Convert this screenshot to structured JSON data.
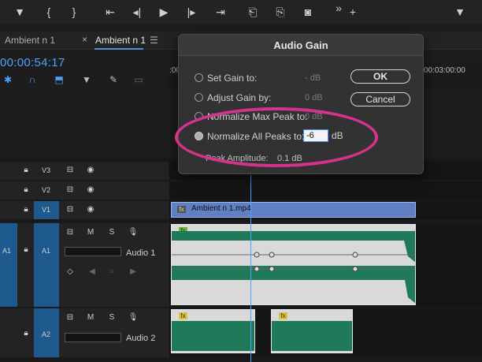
{
  "toolbar": {
    "icons": [
      "marker-icon",
      "mark-in-icon",
      "mark-out-icon",
      "go-to-in-icon",
      "step-back-icon",
      "play-icon",
      "step-forward-icon",
      "go-to-out-icon",
      "lift-icon",
      "extract-icon",
      "export-frame-icon",
      "more-icon",
      "add-icon",
      "marker-icon-right"
    ]
  },
  "tabs": {
    "tab1": "Ambient n 1",
    "close": "×",
    "tab2": "Ambient n 1",
    "menu": "☰"
  },
  "timecode": "00:00:54:17",
  "ruler": {
    "left_label": ":00",
    "right_label": "00:03:00:00"
  },
  "tracks": {
    "v3": "V3",
    "v2": "V2",
    "v1_source": "V1",
    "v1": "V1",
    "a1_source": "A1",
    "a1": "A1",
    "a1_name": "Audio 1",
    "a2": "A2",
    "a2_name": "Audio 2",
    "m": "M",
    "s": "S"
  },
  "clips": {
    "video_name": "Ambient n 1.mp4",
    "fx": "fx"
  },
  "dialog": {
    "title": "Audio Gain",
    "options": [
      {
        "label": "Set Gain to:",
        "value": "- dB"
      },
      {
        "label": "Adjust Gain by:",
        "value": "0 dB"
      },
      {
        "label": "Normalize Max Peak to:",
        "value": "0 dB"
      },
      {
        "label": "Normalize All Peaks to:",
        "value": "-6"
      }
    ],
    "unit": "dB",
    "ok": "OK",
    "cancel": "Cancel",
    "peak_label": "Peak Amplitude:",
    "peak_value": "0.1 dB"
  },
  "colors": {
    "accent": "#4aa3ff",
    "highlight": "#d3338a",
    "waveform": "#1f7a5a",
    "track_target": "#1f5a8f"
  }
}
